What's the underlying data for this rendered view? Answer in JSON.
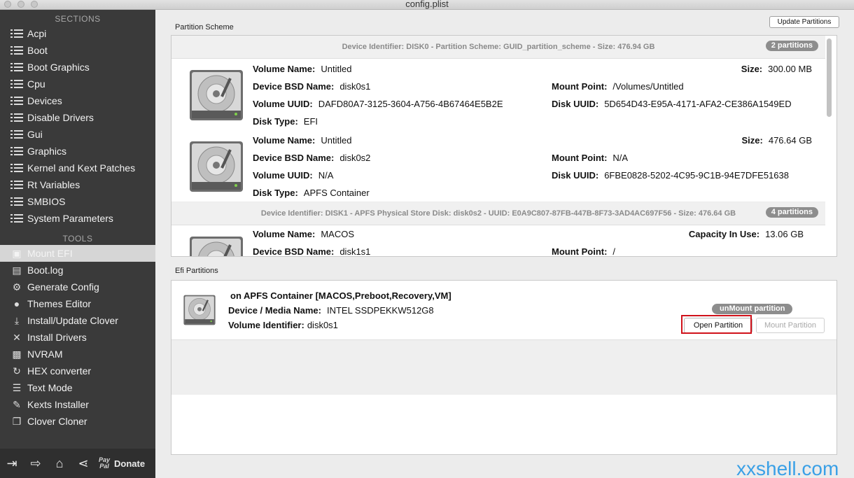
{
  "window": {
    "title": "config.plist"
  },
  "sidebar": {
    "sections_header": "SECTIONS",
    "sections": [
      "Acpi",
      "Boot",
      "Boot Graphics",
      "Cpu",
      "Devices",
      "Disable Drivers",
      "Gui",
      "Graphics",
      "Kernel and Kext Patches",
      "Rt Variables",
      "SMBIOS",
      "System Parameters"
    ],
    "tools_header": "TOOLS",
    "tools": [
      {
        "label": "Mount EFI",
        "icon": "disk-icon",
        "selected": true
      },
      {
        "label": "Boot.log",
        "icon": "log-icon"
      },
      {
        "label": "Generate Config",
        "icon": "gears-icon"
      },
      {
        "label": "Themes Editor",
        "icon": "palette-icon"
      },
      {
        "label": "Install/Update Clover",
        "icon": "download-icon"
      },
      {
        "label": "Install Drivers",
        "icon": "tools-icon"
      },
      {
        "label": "NVRAM",
        "icon": "chip-icon"
      },
      {
        "label": "HEX converter",
        "icon": "refresh-icon"
      },
      {
        "label": "Text Mode",
        "icon": "text-icon"
      },
      {
        "label": "Kexts Installer",
        "icon": "puzzle-icon"
      },
      {
        "label": "Clover Cloner",
        "icon": "copy-icon"
      }
    ],
    "bottom": {
      "paypal_label": "Pay Pal",
      "donate_label": "Donate",
      "icons": [
        "import-icon",
        "export-icon",
        "home-icon",
        "share-icon"
      ]
    }
  },
  "main": {
    "partition_scheme_label": "Partition Scheme",
    "update_button": "Update Partitions",
    "devices": [
      {
        "header": "Device Identifier: DISK0 - Partition Scheme: GUID_partition_scheme - Size: 476.94 GB",
        "badge": "2 partitions",
        "volumes": [
          {
            "volume_name_key": "Volume Name:",
            "volume_name": "Untitled",
            "size_key": "Size:",
            "size": "300.00 MB",
            "bsd_key": "Device BSD Name:",
            "bsd": "disk0s1",
            "mount_key": "Mount Point:",
            "mount": "/Volumes/Untitled",
            "uuid_key": "Volume UUID:",
            "uuid": "DAFD80A7-3125-3604-A756-4B67464E5B2E",
            "disk_uuid_key": "Disk UUID:",
            "disk_uuid": "5D654D43-E95A-4171-AFA2-CE386A1549ED",
            "type_key": "Disk Type:",
            "type": "EFI"
          },
          {
            "volume_name_key": "Volume Name:",
            "volume_name": "Untitled",
            "size_key": "Size:",
            "size": "476.64 GB",
            "bsd_key": "Device BSD Name:",
            "bsd": "disk0s2",
            "mount_key": "Mount Point:",
            "mount": "N/A",
            "uuid_key": "Volume UUID:",
            "uuid": "N/A",
            "disk_uuid_key": "Disk UUID:",
            "disk_uuid": "6FBE0828-5202-4C95-9C1B-94E7DFE51638",
            "type_key": "Disk Type:",
            "type": "APFS Container"
          }
        ]
      },
      {
        "header": "Device Identifier: DISK1 - APFS Physical Store Disk: disk0s2 - UUID: E0A9C807-87FB-447B-8F73-3AD4AC697F56 - Size: 476.64 GB",
        "badge": "4 partitions",
        "volumes": [
          {
            "volume_name_key": "Volume Name:",
            "volume_name": "MACOS",
            "size_key": "Capacity In Use:",
            "size": "13.06 GB",
            "bsd_key": "Device BSD Name:",
            "bsd": "disk1s1",
            "mount_key": "Mount Point:",
            "mount": "/"
          }
        ]
      }
    ],
    "efi_label": "Efi Partitions",
    "efi": {
      "title": "on APFS Container",
      "title_bracket": "[MACOS,Preboot,Recovery,VM]",
      "media_key": "Device / Media Name:",
      "media": "INTEL SSDPEKKW512G8",
      "volid_key": "Volume Identifier:",
      "volid": "disk0s1",
      "unmount_badge": "unMount partition",
      "open_button": "Open Partition",
      "mount_button": "Mount Partition"
    }
  },
  "watermark": "xxshell.com"
}
